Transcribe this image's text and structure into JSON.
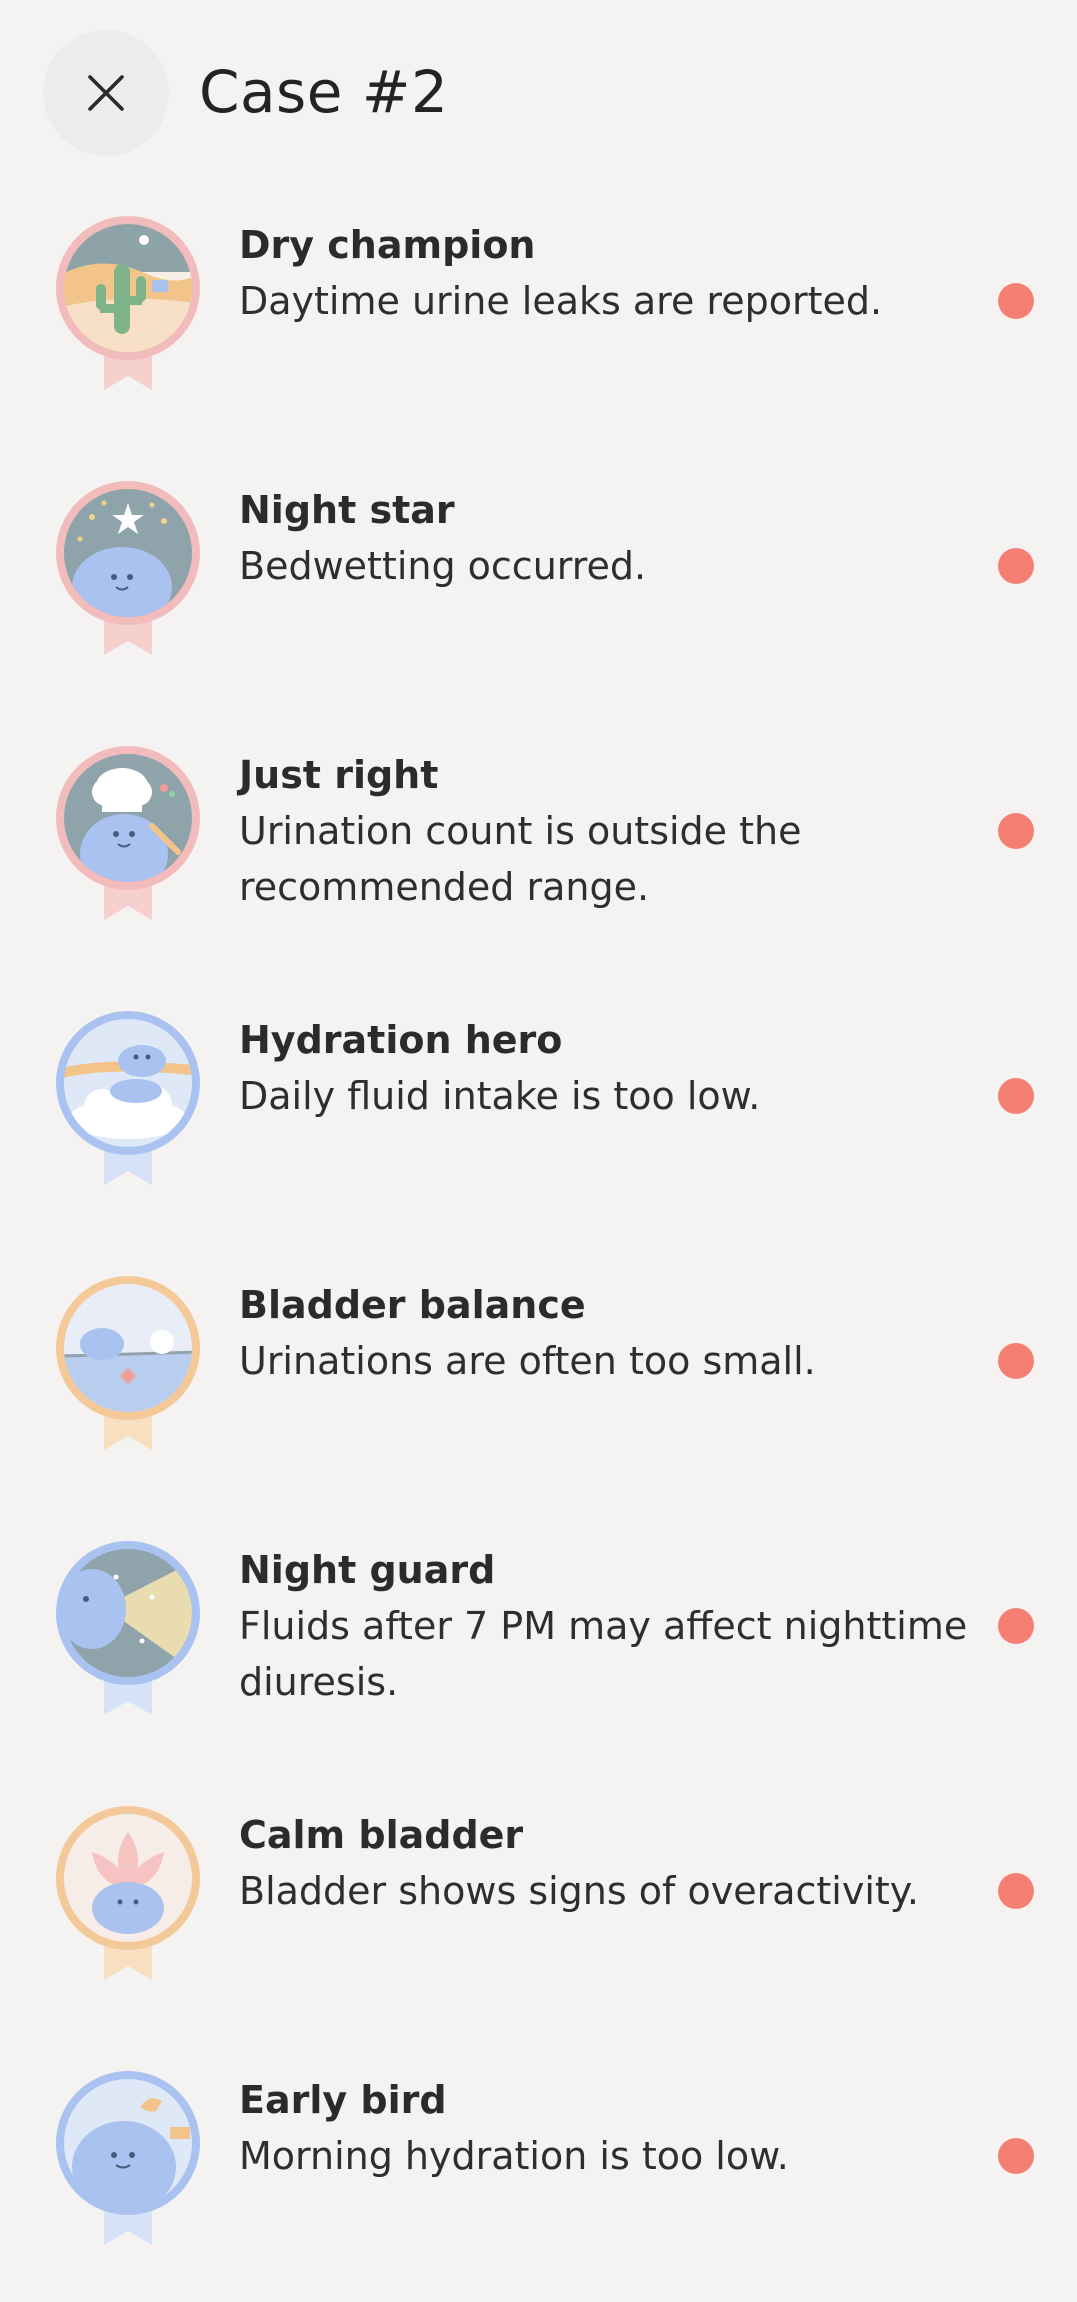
{
  "header": {
    "title": "Case #2",
    "close_icon": "close-icon"
  },
  "colors": {
    "background": "#f4f3f2",
    "status_dot": "#f47f72",
    "badge_pink": "#f3b9b9",
    "badge_blue": "#a9c2f0",
    "badge_orange": "#f4c99a"
  },
  "items": [
    {
      "title": "Dry champion",
      "description": "Daytime urine leaks are reported.",
      "badge_icon": "cactus-desert-badge-icon",
      "badge_color": "pink"
    },
    {
      "title": "Night star",
      "description": "Bedwetting occurred.",
      "badge_icon": "night-star-badge-icon",
      "badge_color": "pink"
    },
    {
      "title": "Just right",
      "description": "Urination count is outside the recommended range.",
      "badge_icon": "chef-badge-icon",
      "badge_color": "pink"
    },
    {
      "title": "Hydration hero",
      "description": "Daily fluid intake is too low.",
      "badge_icon": "cloud-badge-icon",
      "badge_color": "blue"
    },
    {
      "title": "Bladder balance",
      "description": "Urinations are often too small.",
      "badge_icon": "balance-badge-icon",
      "badge_color": "orange"
    },
    {
      "title": "Night guard",
      "description": "Fluids after 7 PM may affect nighttime diuresis.",
      "badge_icon": "flashlight-badge-icon",
      "badge_color": "blue"
    },
    {
      "title": "Calm bladder",
      "description": "Bladder shows signs of overactivity.",
      "badge_icon": "lotus-badge-icon",
      "badge_color": "orange"
    },
    {
      "title": "Early bird",
      "description": "Morning hydration is too low.",
      "badge_icon": "bird-badge-icon",
      "badge_color": "blue"
    }
  ]
}
